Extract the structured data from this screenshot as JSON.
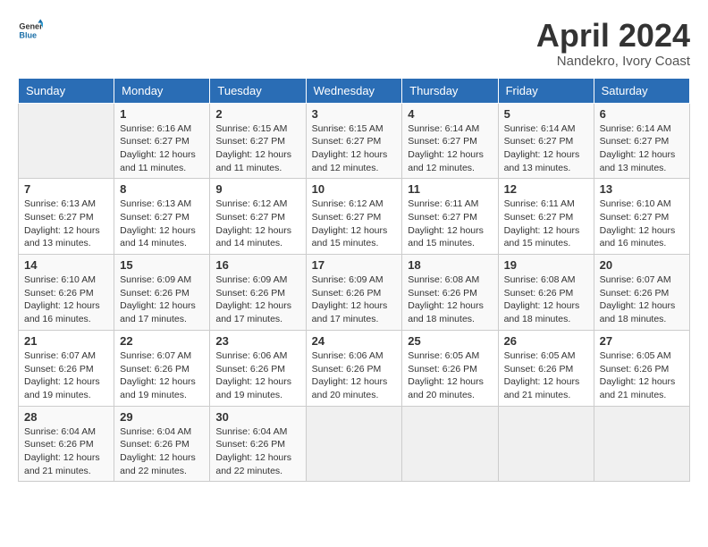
{
  "header": {
    "logo_general": "General",
    "logo_blue": "Blue",
    "title": "April 2024",
    "location": "Nandekro, Ivory Coast"
  },
  "days_of_week": [
    "Sunday",
    "Monday",
    "Tuesday",
    "Wednesday",
    "Thursday",
    "Friday",
    "Saturday"
  ],
  "weeks": [
    [
      {
        "day": "",
        "sunrise": "",
        "sunset": "",
        "daylight": ""
      },
      {
        "day": "1",
        "sunrise": "Sunrise: 6:16 AM",
        "sunset": "Sunset: 6:27 PM",
        "daylight": "Daylight: 12 hours and 11 minutes."
      },
      {
        "day": "2",
        "sunrise": "Sunrise: 6:15 AM",
        "sunset": "Sunset: 6:27 PM",
        "daylight": "Daylight: 12 hours and 11 minutes."
      },
      {
        "day": "3",
        "sunrise": "Sunrise: 6:15 AM",
        "sunset": "Sunset: 6:27 PM",
        "daylight": "Daylight: 12 hours and 12 minutes."
      },
      {
        "day": "4",
        "sunrise": "Sunrise: 6:14 AM",
        "sunset": "Sunset: 6:27 PM",
        "daylight": "Daylight: 12 hours and 12 minutes."
      },
      {
        "day": "5",
        "sunrise": "Sunrise: 6:14 AM",
        "sunset": "Sunset: 6:27 PM",
        "daylight": "Daylight: 12 hours and 13 minutes."
      },
      {
        "day": "6",
        "sunrise": "Sunrise: 6:14 AM",
        "sunset": "Sunset: 6:27 PM",
        "daylight": "Daylight: 12 hours and 13 minutes."
      }
    ],
    [
      {
        "day": "7",
        "sunrise": "Sunrise: 6:13 AM",
        "sunset": "Sunset: 6:27 PM",
        "daylight": "Daylight: 12 hours and 13 minutes."
      },
      {
        "day": "8",
        "sunrise": "Sunrise: 6:13 AM",
        "sunset": "Sunset: 6:27 PM",
        "daylight": "Daylight: 12 hours and 14 minutes."
      },
      {
        "day": "9",
        "sunrise": "Sunrise: 6:12 AM",
        "sunset": "Sunset: 6:27 PM",
        "daylight": "Daylight: 12 hours and 14 minutes."
      },
      {
        "day": "10",
        "sunrise": "Sunrise: 6:12 AM",
        "sunset": "Sunset: 6:27 PM",
        "daylight": "Daylight: 12 hours and 15 minutes."
      },
      {
        "day": "11",
        "sunrise": "Sunrise: 6:11 AM",
        "sunset": "Sunset: 6:27 PM",
        "daylight": "Daylight: 12 hours and 15 minutes."
      },
      {
        "day": "12",
        "sunrise": "Sunrise: 6:11 AM",
        "sunset": "Sunset: 6:27 PM",
        "daylight": "Daylight: 12 hours and 15 minutes."
      },
      {
        "day": "13",
        "sunrise": "Sunrise: 6:10 AM",
        "sunset": "Sunset: 6:27 PM",
        "daylight": "Daylight: 12 hours and 16 minutes."
      }
    ],
    [
      {
        "day": "14",
        "sunrise": "Sunrise: 6:10 AM",
        "sunset": "Sunset: 6:26 PM",
        "daylight": "Daylight: 12 hours and 16 minutes."
      },
      {
        "day": "15",
        "sunrise": "Sunrise: 6:09 AM",
        "sunset": "Sunset: 6:26 PM",
        "daylight": "Daylight: 12 hours and 17 minutes."
      },
      {
        "day": "16",
        "sunrise": "Sunrise: 6:09 AM",
        "sunset": "Sunset: 6:26 PM",
        "daylight": "Daylight: 12 hours and 17 minutes."
      },
      {
        "day": "17",
        "sunrise": "Sunrise: 6:09 AM",
        "sunset": "Sunset: 6:26 PM",
        "daylight": "Daylight: 12 hours and 17 minutes."
      },
      {
        "day": "18",
        "sunrise": "Sunrise: 6:08 AM",
        "sunset": "Sunset: 6:26 PM",
        "daylight": "Daylight: 12 hours and 18 minutes."
      },
      {
        "day": "19",
        "sunrise": "Sunrise: 6:08 AM",
        "sunset": "Sunset: 6:26 PM",
        "daylight": "Daylight: 12 hours and 18 minutes."
      },
      {
        "day": "20",
        "sunrise": "Sunrise: 6:07 AM",
        "sunset": "Sunset: 6:26 PM",
        "daylight": "Daylight: 12 hours and 18 minutes."
      }
    ],
    [
      {
        "day": "21",
        "sunrise": "Sunrise: 6:07 AM",
        "sunset": "Sunset: 6:26 PM",
        "daylight": "Daylight: 12 hours and 19 minutes."
      },
      {
        "day": "22",
        "sunrise": "Sunrise: 6:07 AM",
        "sunset": "Sunset: 6:26 PM",
        "daylight": "Daylight: 12 hours and 19 minutes."
      },
      {
        "day": "23",
        "sunrise": "Sunrise: 6:06 AM",
        "sunset": "Sunset: 6:26 PM",
        "daylight": "Daylight: 12 hours and 19 minutes."
      },
      {
        "day": "24",
        "sunrise": "Sunrise: 6:06 AM",
        "sunset": "Sunset: 6:26 PM",
        "daylight": "Daylight: 12 hours and 20 minutes."
      },
      {
        "day": "25",
        "sunrise": "Sunrise: 6:05 AM",
        "sunset": "Sunset: 6:26 PM",
        "daylight": "Daylight: 12 hours and 20 minutes."
      },
      {
        "day": "26",
        "sunrise": "Sunrise: 6:05 AM",
        "sunset": "Sunset: 6:26 PM",
        "daylight": "Daylight: 12 hours and 21 minutes."
      },
      {
        "day": "27",
        "sunrise": "Sunrise: 6:05 AM",
        "sunset": "Sunset: 6:26 PM",
        "daylight": "Daylight: 12 hours and 21 minutes."
      }
    ],
    [
      {
        "day": "28",
        "sunrise": "Sunrise: 6:04 AM",
        "sunset": "Sunset: 6:26 PM",
        "daylight": "Daylight: 12 hours and 21 minutes."
      },
      {
        "day": "29",
        "sunrise": "Sunrise: 6:04 AM",
        "sunset": "Sunset: 6:26 PM",
        "daylight": "Daylight: 12 hours and 22 minutes."
      },
      {
        "day": "30",
        "sunrise": "Sunrise: 6:04 AM",
        "sunset": "Sunset: 6:26 PM",
        "daylight": "Daylight: 12 hours and 22 minutes."
      },
      {
        "day": "",
        "sunrise": "",
        "sunset": "",
        "daylight": ""
      },
      {
        "day": "",
        "sunrise": "",
        "sunset": "",
        "daylight": ""
      },
      {
        "day": "",
        "sunrise": "",
        "sunset": "",
        "daylight": ""
      },
      {
        "day": "",
        "sunrise": "",
        "sunset": "",
        "daylight": ""
      }
    ]
  ]
}
